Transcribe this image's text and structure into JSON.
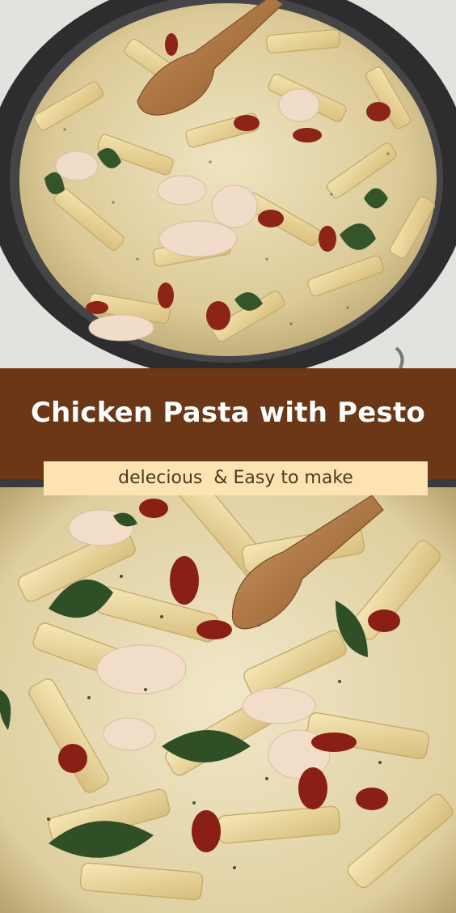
{
  "title": "Chicken Pasta with Pesto",
  "subtitle": "delecious  & Easy to make",
  "images": {
    "top": "Creamy penne with chicken, spinach and sun-dried tomatoes in a dark skillet with a wooden spoon",
    "bottom": "Close-up of creamy penne pasta with chicken, spinach, sun-dried tomatoes and cracked pepper with a wooden spoon"
  },
  "colors": {
    "band": "#6b3716",
    "subtitle_box": "#fde3b2",
    "title_text": "#ffffff",
    "subtitle_text": "#4a3a1f"
  }
}
